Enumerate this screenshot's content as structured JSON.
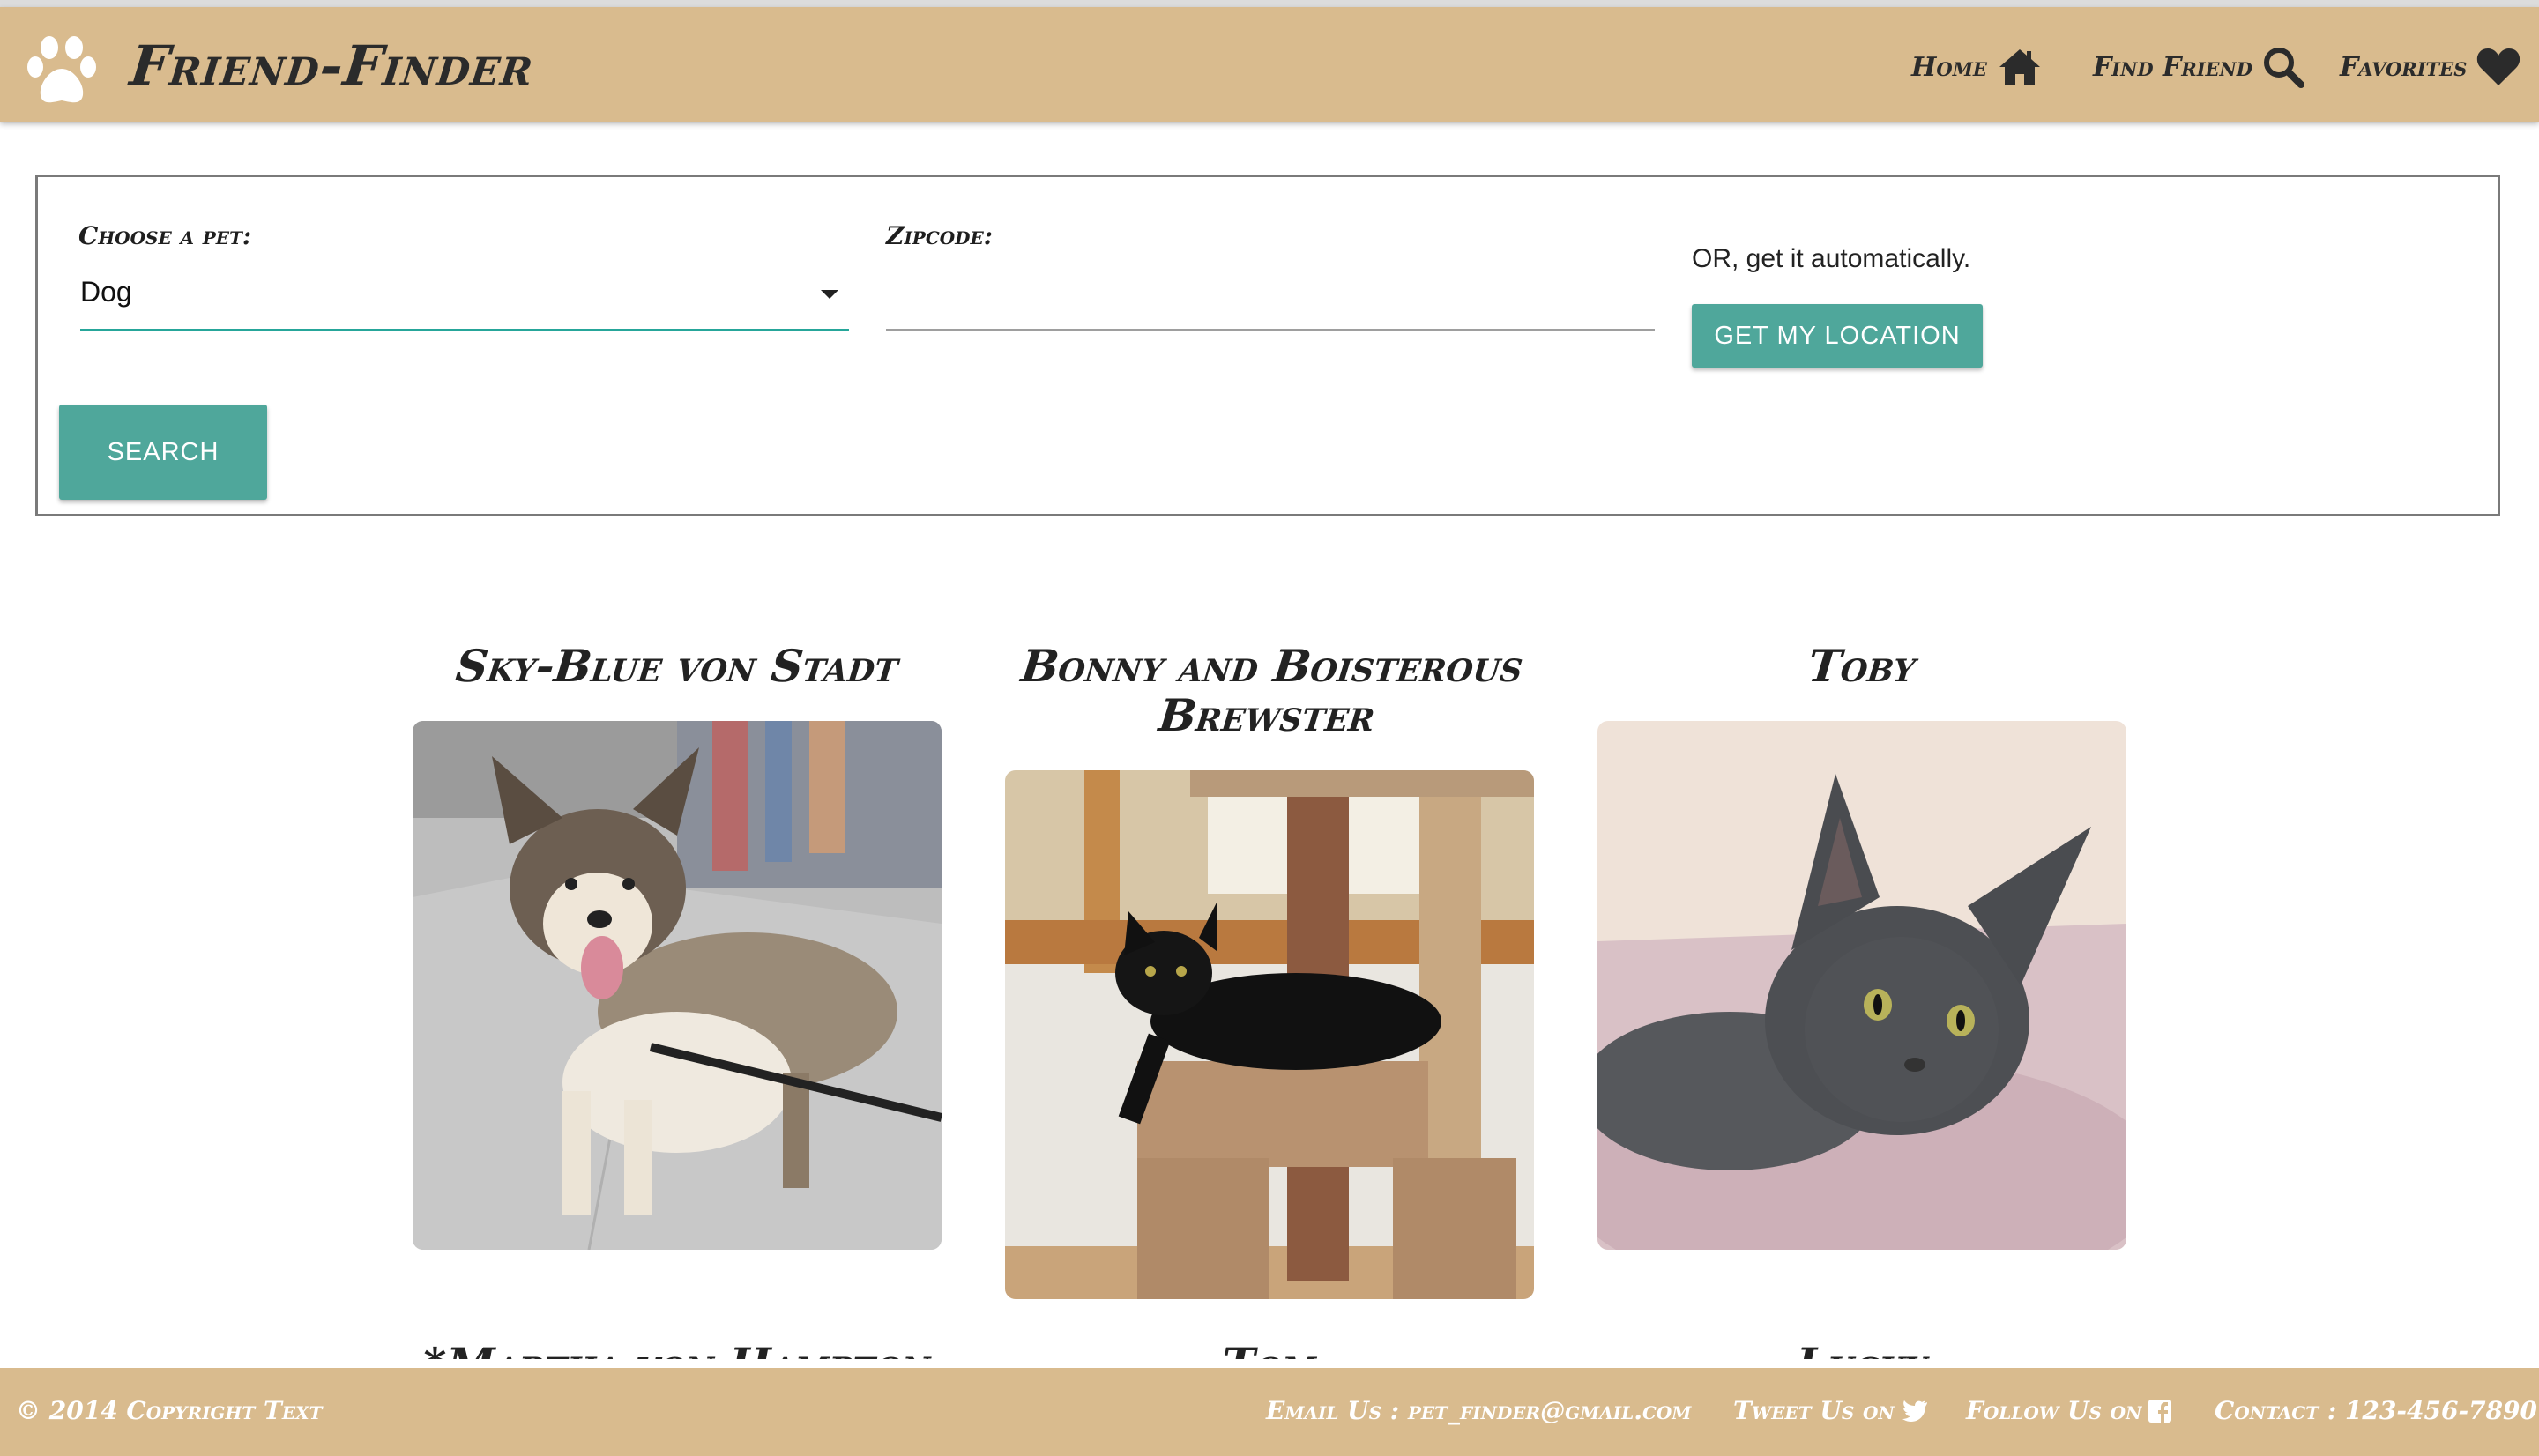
{
  "header": {
    "brand": "Friend-Finder",
    "nav": {
      "home": "Home",
      "find": "Find Friend",
      "favorites": "Favorites"
    }
  },
  "search": {
    "pet_label": "Choose a pet:",
    "pet_value": "Dog",
    "zip_label": "Zipcode:",
    "zip_value": "",
    "auto_text": "OR, get it automatically.",
    "location_button": "GET MY LOCATION",
    "search_button": "SEARCH"
  },
  "pets": [
    {
      "name": "Sky-Blue von Stadt",
      "image": "dog-photo"
    },
    {
      "name": "Bonny and Boisterous Brewster",
      "image": "black-cat-photo"
    },
    {
      "name": "Toby",
      "image": "gray-cat-photo"
    }
  ],
  "next_row_peek": [
    "*Martha von Hampton",
    "Tom",
    "Lucky"
  ],
  "footer": {
    "copyright": "© 2014 Copyright Text",
    "email": "Email Us : pet_finder@gmail.com",
    "tweet": "Tweet Us on",
    "follow": "Follow Us on",
    "contact": "Contact : 123-456-7890"
  },
  "colors": {
    "header_bg": "#d9bb8e",
    "accent": "#4fa79b",
    "select_underline": "#26a69a"
  }
}
